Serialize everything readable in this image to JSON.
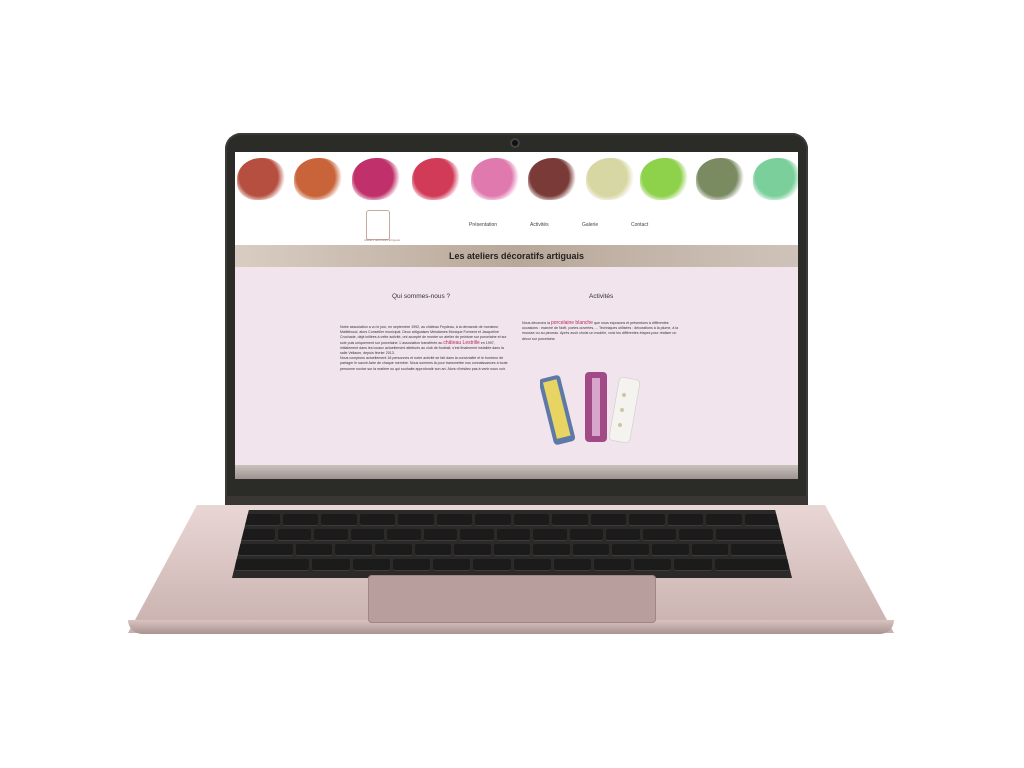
{
  "site": {
    "title": "Les ateliers décoratifs artiguais",
    "logo_text": "Ateliers décoratifs artiguais",
    "nav": [
      "Présentation",
      "Activités",
      "Galerie",
      "Contact"
    ]
  },
  "swatch_colors": [
    "#b64f3f",
    "#c9643a",
    "#c0306a",
    "#d23b58",
    "#e07aae",
    "#7a3b38",
    "#d7d7a4",
    "#8ed14a",
    "#7a8b62",
    "#7bcf9b"
  ],
  "left_column": {
    "heading": "Qui sommes-nous ?",
    "paragraph_1": "Notre association a vu le jour, en septembre 1992, au château Feydeau, à la demande de monsieur Mailleboud, alors Conseiller municipal. Deux artiguaises Mesdames Monique Forment et Jacqueline Cruchade, déjà initiées à cette activité, ont accepté de monter un atelier de peinture sur porcelaine et sur soie puis uniquement sur porcelaine. L'association transférée au",
    "highlight": "château Lestrille",
    "paragraph_1b": "en 1997, initialement dans les locaux actuellement attribués au club de football, s'est finalement installée dans la salle Vellaum, depuis février 2013.",
    "paragraph_2": "Nous comptons actuellement 18 personnes et notre activité se fait dans la convivialité et le bonheur de partager le savoir-faire de chaque membre. Nous sommes là pour transmettre nos connaissances à toute personne novice sur la matière ou qui souhaite approfondir son art. Alors n'hésitez pas à venir nous voir."
  },
  "right_column": {
    "heading": "Activités",
    "intro": "Nous décorons la",
    "highlight": "porcelaine blanche",
    "text": "que nous exposons et présentons à différentes occasions : marché de Noël, portes ouvertes, ... Techniques utilisées : décorations à la plume, à la mousse ou au pinceau. Après avoir choisi un modèle, voici les différentes étapes pour réaliser un décor sur porcelaine."
  }
}
